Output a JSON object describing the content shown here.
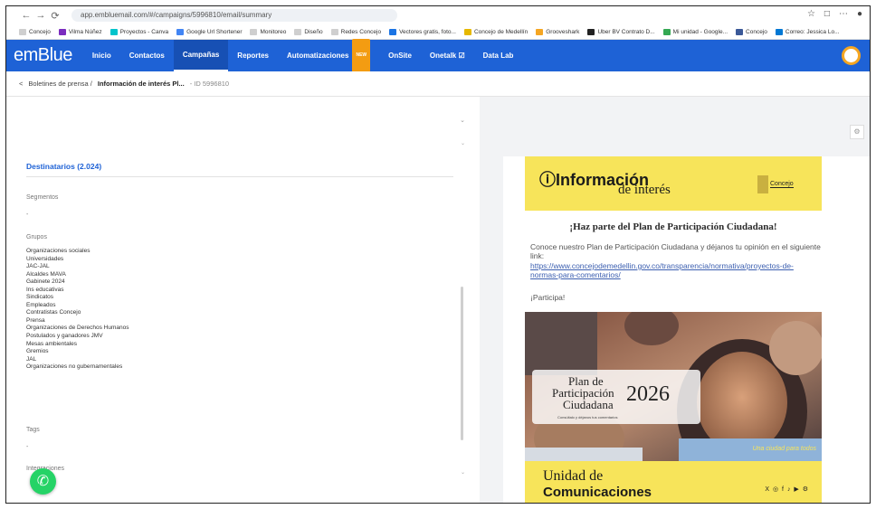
{
  "browser": {
    "url": "app.embluemail.com/#/campaigns/5996810/email/summary",
    "nav": [
      "←",
      "→",
      "⟳"
    ],
    "right_icons": [
      "☆",
      "□",
      "⋯",
      "●"
    ]
  },
  "bookmarks": [
    {
      "label": "Concejo",
      "color": "#cfcfcf"
    },
    {
      "label": "Vilma Núñez",
      "color": "#7b2cbf"
    },
    {
      "label": "Proyectos - Canva",
      "color": "#00c4cc"
    },
    {
      "label": "Google Url Shortener",
      "color": "#4285f4"
    },
    {
      "label": "Monitoreo",
      "color": "#cfcfcf"
    },
    {
      "label": "Diseño",
      "color": "#cfcfcf"
    },
    {
      "label": "Redes Concejo",
      "color": "#cfcfcf"
    },
    {
      "label": "Vectores gratis, foto...",
      "color": "#1b74e4"
    },
    {
      "label": "Concejo de Medellín",
      "color": "#e6b800"
    },
    {
      "label": "Grooveshark",
      "color": "#f5a623"
    },
    {
      "label": "Uber BV Contrato D...",
      "color": "#222222"
    },
    {
      "label": "Mi unidad - Google...",
      "color": "#34a853"
    },
    {
      "label": "Concejo",
      "color": "#3b5998"
    },
    {
      "label": "Correo: Jessica Lo...",
      "color": "#0078d4"
    }
  ],
  "app": {
    "logo": "emBlue",
    "nav": [
      {
        "label": "Inicio",
        "active": false
      },
      {
        "label": "Contactos",
        "active": false
      },
      {
        "label": "Campañas",
        "active": true
      },
      {
        "label": "Reportes",
        "active": false
      },
      {
        "label": "Automatizaciones",
        "active": false,
        "badge": "NEW"
      },
      {
        "label": "OnSite",
        "active": false
      },
      {
        "label": "Onetalk ☑",
        "active": false
      },
      {
        "label": "Data Lab",
        "active": false
      }
    ]
  },
  "breadcrumb": {
    "back": "<",
    "parent": "Boletines de prensa /",
    "current": "Información de interés Pl...",
    "id": "- ID 5996810"
  },
  "left": {
    "collapse_icon": "⌄",
    "recipients_title": "Destinatarios (2.024)",
    "segments_label": "Segmentos",
    "segments_value": "-",
    "groups_label": "Grupos",
    "groups": [
      "Organizaciones sociales",
      "Universidades",
      "JAC-JAL",
      "Alcaldes MAVA",
      "Gabinete 2024",
      "Ins educativas",
      "Sindicatos",
      "Empleados",
      "Contratistas Concejo",
      "Prensa",
      "Organizaciones de Derechos Humanos",
      "Postulados y ganadores JMV",
      "Mesas ambientales",
      "Gremios",
      "JAL",
      "Organizaciones no gubernamentales"
    ],
    "tags_label": "Tags",
    "tags_value": "-",
    "integrations_label": "Integraciones",
    "scroll_mark": "⌄"
  },
  "email": {
    "settings_icon": "⚙",
    "header_line1": "ⓘInformación",
    "header_line2": "de interés",
    "seal_text": "Concejo",
    "headline": "¡Haz parte del Plan de Participación Ciudadana!",
    "paragraph": "Conoce nuestro Plan de Participación Ciudadana y déjanos tu opinión en el siguiente link:",
    "link": "https://www.concejodemedellin.gov.co/transparencia/normativa/proyectos-de-normas-para-comentarios/",
    "cta": "¡Participa!",
    "plan_l1": "Plan de",
    "plan_l2": "Participación",
    "plan_l3": "Ciudadana",
    "plan_year": "2026",
    "plan_sub": "Consúltalo y déjanos tus comentarios",
    "tagline": "Una ciudad para todos",
    "footer_l1": "Unidad de",
    "footer_l2": "Comunicaciones",
    "socials": "X ◎ f ♪ ▶ ⚙"
  }
}
